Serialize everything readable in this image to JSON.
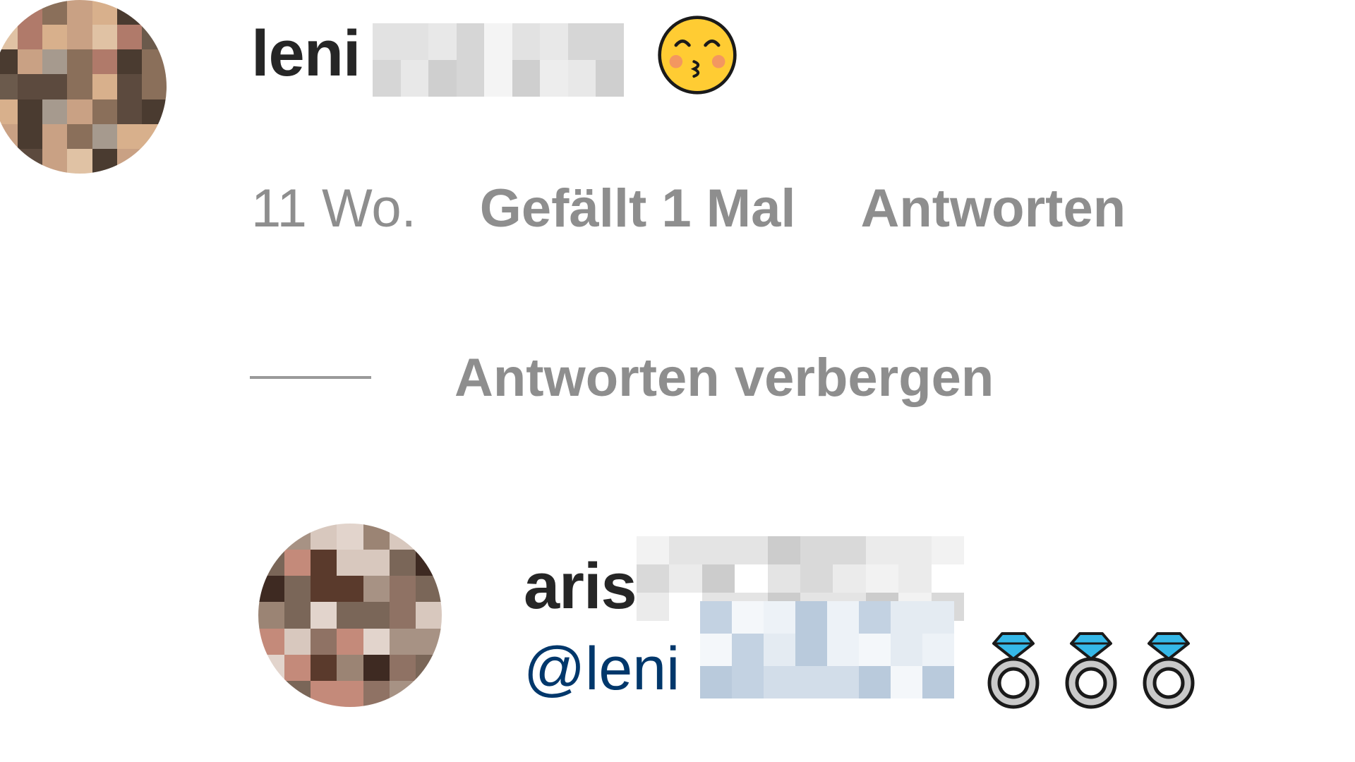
{
  "comment": {
    "username_visible": "leni",
    "emoji": "kissing-face-with-smiling-eyes-emoji",
    "time": "11 Wo.",
    "likes": "Gefällt 1 Mal",
    "reply_label": "Antworten"
  },
  "thread": {
    "hide_replies_label": "Antworten verbergen"
  },
  "reply": {
    "username_visible": "aris",
    "mention_visible": "@leni",
    "emoji": "ring-emoji",
    "emoji_count": 3
  },
  "colors": {
    "username": "#262626",
    "meta": "#8e8e8e",
    "mention": "#00376b",
    "background": "#ffffff"
  }
}
